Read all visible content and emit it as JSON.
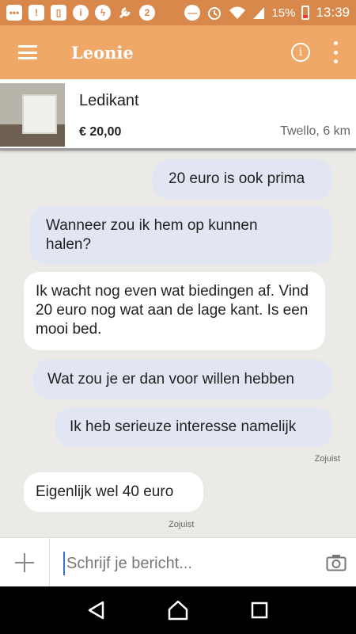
{
  "status_bar": {
    "battery": "15%",
    "time": "13:39",
    "icons": [
      "chat-icon",
      "alert-icon",
      "sim-icon",
      "info-icon",
      "messenger-icon",
      "wrench-icon",
      "data-icon",
      "dnd-icon",
      "alarm-icon",
      "wifi-icon",
      "signal-icon",
      "battery-icon"
    ]
  },
  "app_bar": {
    "title": "Leonie"
  },
  "listing": {
    "title": "Ledikant",
    "price": "€ 20,00",
    "location": "Twello, 6 km"
  },
  "messages": [
    {
      "direction": "out",
      "text": "20 euro is ook prima"
    },
    {
      "direction": "out",
      "text": "Wanneer zou ik hem op kunnen halen?"
    },
    {
      "direction": "in",
      "text": "Ik wacht nog even wat biedingen af. Vind 20 euro nog wat aan de lage kant. Is een mooi bed."
    },
    {
      "direction": "out",
      "text": "Wat zou je er dan voor willen hebben"
    },
    {
      "direction": "out",
      "text": "Ik heb serieuze interesse namelijk",
      "time": "Zojuist"
    },
    {
      "direction": "in",
      "text": "Eigenlijk wel 40 euro",
      "time": "Zojuist"
    }
  ],
  "composer": {
    "placeholder": "Schrijf je bericht..."
  },
  "colors": {
    "accent": "#EFA868",
    "status_bar": "#D8884A",
    "outgoing_bubble": "#E2E6F2",
    "incoming_bubble": "#FFFFFF"
  }
}
